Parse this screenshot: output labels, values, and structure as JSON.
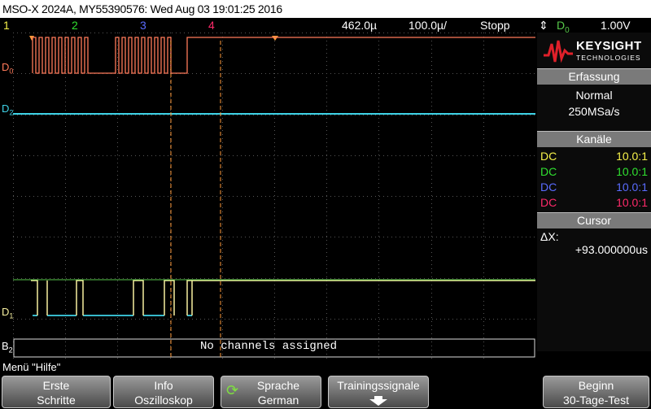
{
  "title": "MSO-X 2024A, MY55390576: Wed Aug 03 19:01:25 2016",
  "status": {
    "ch1": "1",
    "ch2": "2",
    "ch3": "3",
    "ch4": "4",
    "timebase": "462.0µ",
    "delay": "100.0µ/",
    "run_state": "Stopp",
    "trigger_source": "D",
    "trigger_source_sub": "0",
    "trigger_level": "1.00V"
  },
  "waveform_labels": {
    "d0": "D",
    "d0_sub": "0",
    "d2": "D",
    "d2_sub": "2",
    "d1": "D",
    "d1_sub": "1",
    "b2": "B",
    "b2_sub": "2",
    "bus_message": "No channels assigned"
  },
  "brand": {
    "name": "KEYSIGHT",
    "sub": "TECHNOLOGIES"
  },
  "acquisition": {
    "header": "Erfassung",
    "mode": "Normal",
    "rate": "250MSa/s"
  },
  "channels": {
    "header": "Kanäle",
    "rows": [
      {
        "coupling": "DC",
        "probe": "10.0:1",
        "color": "#f7f24a"
      },
      {
        "coupling": "DC",
        "probe": "10.0:1",
        "color": "#30e030"
      },
      {
        "coupling": "DC",
        "probe": "10.0:1",
        "color": "#5a6cff"
      },
      {
        "coupling": "DC",
        "probe": "10.0:1",
        "color": "#ff2a6a"
      }
    ]
  },
  "cursor": {
    "header": "Cursor",
    "label": "ΔX:",
    "value": "+93.000000us"
  },
  "menu": {
    "title": "Menü \"Hilfe\"",
    "softkeys": [
      {
        "line1": "Erste",
        "line2": "Schritte"
      },
      {
        "line1": "Info",
        "line2": "Oszilloskop"
      },
      {
        "line1": "Sprache",
        "line2": "German"
      },
      {
        "line1": "Trainingssignale",
        "line2": ""
      },
      {
        "line1": "Beginn",
        "line2": "30-Tage-Test"
      }
    ]
  },
  "colors": {
    "d0": "#ff7a5a",
    "d1_high": "#f7f0a0",
    "d1_low": "#3ed2e6",
    "d2": "#3ed2e6",
    "grid": "#5a5a5a",
    "cursor": "#ff9a3a",
    "divider_green": "#57c84a"
  }
}
